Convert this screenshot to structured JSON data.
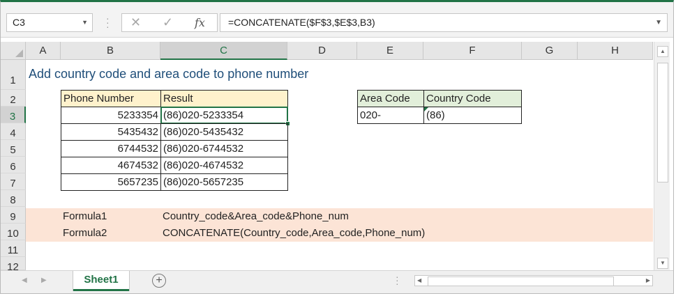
{
  "formula_bar": {
    "name_box": "C3",
    "cancel_icon": "✕",
    "enter_icon": "✓",
    "fx_label": "fx",
    "formula": "=CONCATENATE($F$3,$E$3,B3)"
  },
  "columns": [
    "A",
    "B",
    "C",
    "D",
    "E",
    "F",
    "G",
    "H"
  ],
  "rows": [
    "1",
    "2",
    "3",
    "4",
    "5",
    "6",
    "7",
    "8",
    "9",
    "10",
    "11",
    "12"
  ],
  "selected_cell": "C3",
  "sheet": {
    "title": "Add country code and area code to phone number",
    "table_headers": {
      "phone": "Phone Number",
      "result": "Result"
    },
    "table_rows": [
      {
        "phone": "5233354",
        "result": "(86)020-5233354"
      },
      {
        "phone": "5435432",
        "result": "(86)020-5435432"
      },
      {
        "phone": "6744532",
        "result": "(86)020-6744532"
      },
      {
        "phone": "4674532",
        "result": "(86)020-4674532"
      },
      {
        "phone": "5657235",
        "result": "(86)020-5657235"
      }
    ],
    "codes_headers": {
      "area": "Area Code",
      "country": "Country Code"
    },
    "codes_values": {
      "area": "020-",
      "country": "(86)"
    },
    "formulas": [
      {
        "label": "Formula1",
        "text": "Country_code&Area_code&Phone_num"
      },
      {
        "label": "Formula2",
        "text": "CONCATENATE(Country_code,Area_code,Phone_num)"
      }
    ]
  },
  "bottom_bar": {
    "sheet_tab": "Sheet1",
    "add_sheet": "+"
  },
  "colors": {
    "accent": "#217346",
    "header_fill": "#fff2cc",
    "codes_fill": "#e2efda",
    "formula_fill": "#fce4d6",
    "title_color": "#1f4e79"
  }
}
